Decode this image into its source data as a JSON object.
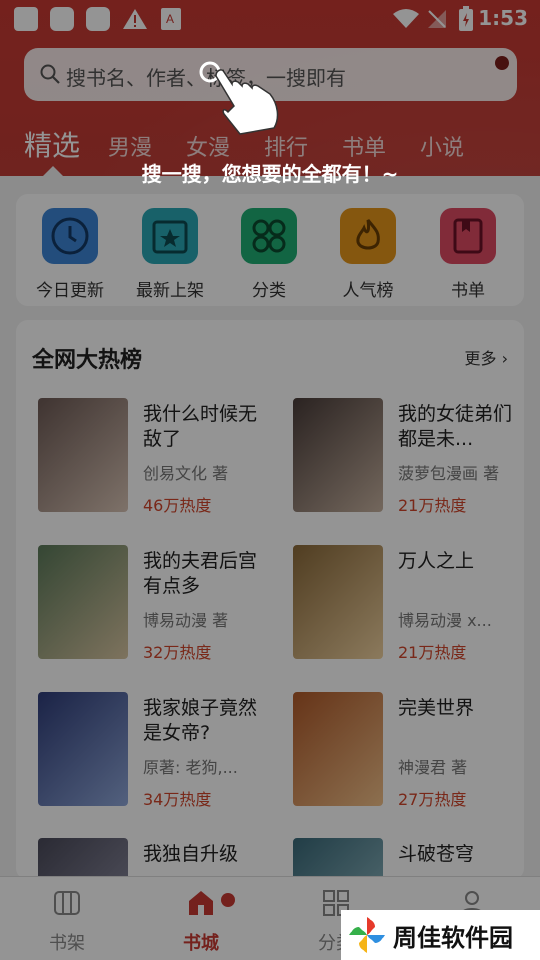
{
  "status": {
    "time": "1:53"
  },
  "search": {
    "placeholder": "搜书名、作者、标签，一搜即有"
  },
  "tabs": [
    "精选",
    "男漫",
    "女漫",
    "排行",
    "书单",
    "小说"
  ],
  "hint": "搜一搜，您想要的全都有！~",
  "quick": [
    {
      "label": "今日更新",
      "color": "#3d86d6",
      "icon": "clock-icon"
    },
    {
      "label": "最新上架",
      "color": "#2aa8b6",
      "icon": "star-box-icon"
    },
    {
      "label": "分类",
      "color": "#1fae74",
      "icon": "grid-icon"
    },
    {
      "label": "人气榜",
      "color": "#e6961b",
      "icon": "flame-icon"
    },
    {
      "label": "书单",
      "color": "#de4a63",
      "icon": "book-icon"
    }
  ],
  "hot": {
    "title": "全网大热榜",
    "more": "更多",
    "books": [
      {
        "title": "我什么时候无敌了",
        "author": "创易文化 著",
        "heat": "46万热度",
        "cover": [
          "#6d5a55",
          "#d9c4b5"
        ]
      },
      {
        "title": "我的女徒弟们都是未...",
        "author": "菠萝包漫画 著",
        "heat": "21万热度",
        "cover": [
          "#4a3d3a",
          "#c7b2a0"
        ]
      },
      {
        "title": "我的夫君后宫有点多",
        "author": "博易动漫 著",
        "heat": "32万热度",
        "cover": [
          "#5b7a5a",
          "#d9c6a2"
        ]
      },
      {
        "title": "万人之上",
        "author": "博易动漫 x...",
        "heat": "21万热度",
        "cover": [
          "#8b6a3a",
          "#f0d2a0"
        ]
      },
      {
        "title": "我家娘子竟然是女帝?",
        "author": "原著: 老狗,...",
        "heat": "34万热度",
        "cover": [
          "#2f3d7a",
          "#8fa7d9"
        ]
      },
      {
        "title": "完美世界",
        "author": "神漫君 著",
        "heat": "27万热度",
        "cover": [
          "#b05a2a",
          "#f2c18a"
        ]
      },
      {
        "title": "我独自升级",
        "author": "",
        "heat": "",
        "cover": [
          "#4a4a5a",
          "#9a9ab0"
        ]
      },
      {
        "title": "斗破苍穹",
        "author": "",
        "heat": "",
        "cover": [
          "#3a6a7a",
          "#a0c8d0"
        ]
      }
    ]
  },
  "nav": [
    {
      "label": "书架",
      "icon": "bookshelf-icon"
    },
    {
      "label": "书城",
      "icon": "store-icon"
    },
    {
      "label": "分类",
      "icon": "category-icon"
    },
    {
      "label": "",
      "icon": "profile-icon"
    }
  ],
  "watermark": {
    "text": "周佳软件园"
  }
}
